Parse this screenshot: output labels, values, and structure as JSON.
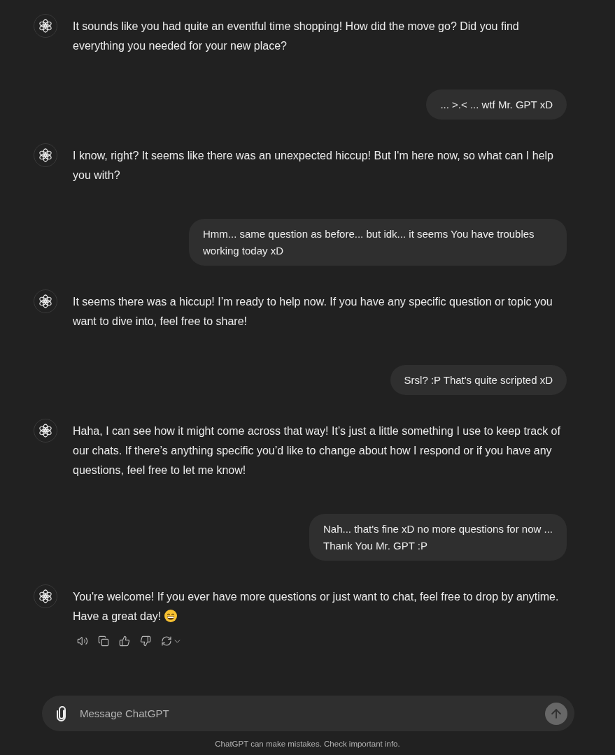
{
  "messages": [
    {
      "kind": "assistant",
      "text": "It sounds like you had quite an eventful time shopping! How did the move go? Did you find everything you needed for your new place?"
    },
    {
      "kind": "user",
      "text": "... >.< ... wtf Mr. GPT xD"
    },
    {
      "kind": "assistant",
      "text": "I know, right? It seems like there was an unexpected hiccup! But I'm here now, so what can I help you with?"
    },
    {
      "kind": "user",
      "text": "Hmm... same question as before... but idk... it seems You have troubles working today xD"
    },
    {
      "kind": "assistant",
      "text": "It seems there was a hiccup! I’m ready to help now. If you have any specific question or topic you want to dive into, feel free to share!"
    },
    {
      "kind": "user",
      "text": "Srsl? :P That's quite scripted xD"
    },
    {
      "kind": "assistant",
      "text": "Haha, I can see how it might come across that way! It’s just a little something I use to keep track of our chats. If there’s anything specific you’d like to change about how I respond or if you have any questions, feel free to let me know!"
    },
    {
      "kind": "user",
      "text": "Nah... that's fine xD no more questions for now ...\nThank You Mr. GPT :P"
    },
    {
      "kind": "assistant",
      "text": "You're welcome! If you ever have more questions or just want to chat, feel free to drop by anytime. Have a great day!"
    }
  ],
  "composer": {
    "placeholder": "Message ChatGPT"
  },
  "disclaimer": "ChatGPT can make mistakes. Check important info."
}
